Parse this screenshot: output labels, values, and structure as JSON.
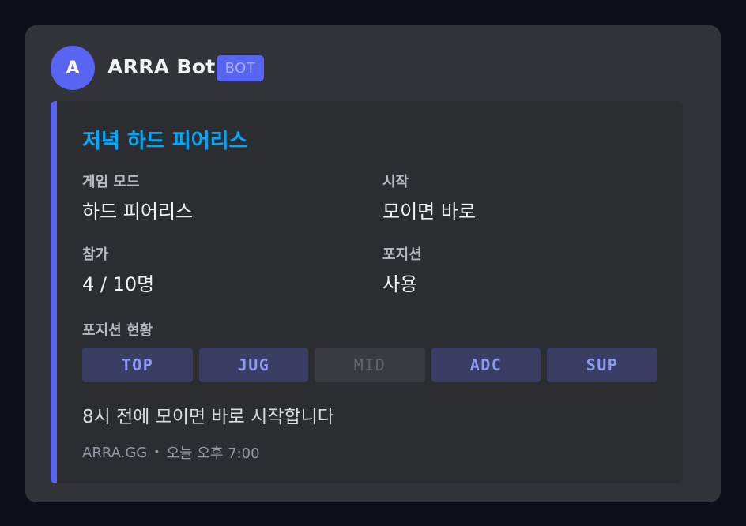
{
  "author": {
    "avatar_letter": "A",
    "name": "ARRA Bot",
    "tag": "BOT"
  },
  "embed": {
    "title": "저녁 하드 피어리스",
    "fields": [
      {
        "name": "게임 모드",
        "value": "하드 피어리스"
      },
      {
        "name": "시작",
        "value": "모이면 바로"
      },
      {
        "name": "참가",
        "value": "4 / 10명"
      },
      {
        "name": "포지션",
        "value": "사용"
      }
    ],
    "positions_label": "포지션 현황",
    "positions": [
      {
        "label": "TOP",
        "state": "open"
      },
      {
        "label": "JUG",
        "state": "open"
      },
      {
        "label": "MID",
        "state": "taken"
      },
      {
        "label": "ADC",
        "state": "open"
      },
      {
        "label": "SUP",
        "state": "open"
      }
    ],
    "description": "8시 전에 모이면 바로 시작합니다",
    "footer_text": "ARRA.GG",
    "footer_sep": "•",
    "timestamp": "오늘 오후 7:00"
  },
  "colors": {
    "background": "#0c0f1a",
    "card": "#313338",
    "embed": "#2b2d31",
    "accent": "#5865f2",
    "title": "#00a8fc"
  }
}
